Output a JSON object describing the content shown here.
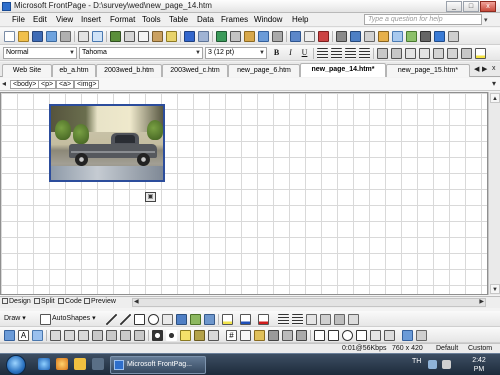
{
  "window": {
    "title": "Microsoft FrontPage - D:\\survey\\wed\\new_page_14.htm",
    "controls": {
      "minimize": "_",
      "maximize": "□",
      "close": "x"
    }
  },
  "menu": {
    "items": [
      "File",
      "Edit",
      "View",
      "Insert",
      "Format",
      "Tools",
      "Table",
      "Data",
      "Frames",
      "Window",
      "Help"
    ],
    "help_placeholder": "Type a question for help",
    "help_dropdown": "▾"
  },
  "format_toolbar": {
    "style": "Normal",
    "font": "Tahoma",
    "size": "3 (12 pt)",
    "bold": "B",
    "italic": "I",
    "underline": "U"
  },
  "tabs": {
    "items": [
      {
        "label": "Web Site"
      },
      {
        "label": "eb_a.htm"
      },
      {
        "label": "2003wed_b.htm"
      },
      {
        "label": "2003wed_c.htm"
      },
      {
        "label": "new_page_6.htm"
      },
      {
        "label": "new_page_14.htm*"
      },
      {
        "label": "new_page_15.htm*"
      }
    ],
    "active_index": 5,
    "nav_left": "◀",
    "nav_right": "▶",
    "close": "x"
  },
  "tag_selector": {
    "tags": [
      "<body>",
      "<p>",
      "<a>",
      "<img>"
    ],
    "dropdown": "▾"
  },
  "view_modes": {
    "design": "Design",
    "split": "Split",
    "code": "Code",
    "preview": "Preview"
  },
  "drawing_toolbar": {
    "draw": "Draw ▾",
    "autoshapes": "AutoShapes ▾"
  },
  "status": {
    "download": "0:01@56Kbps",
    "page_size": "760 x 420",
    "mode1": "Default",
    "mode2": "Custom"
  },
  "taskbar": {
    "app_button": "Microsoft FrontPag...",
    "tray_lang": "TH",
    "clock_time": "2:42",
    "clock_ampm": "PM"
  },
  "colors": {
    "selection": "#2c4d9c",
    "accent": "#2e6ecb"
  }
}
